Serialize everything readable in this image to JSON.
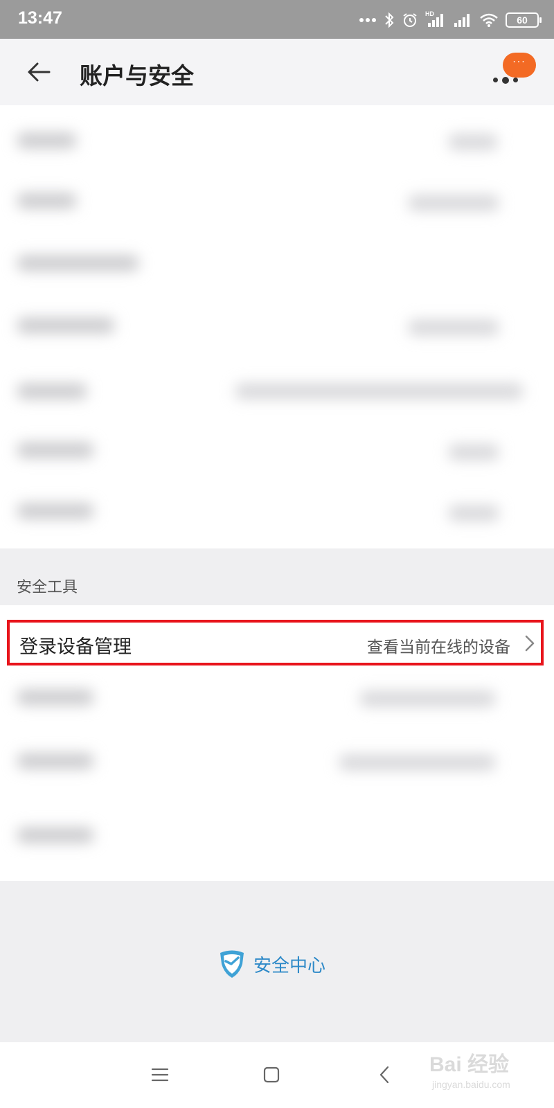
{
  "status_bar": {
    "time": "13:47",
    "network_label": "HD",
    "battery_level": "60",
    "icons": [
      "more-dots-icon",
      "bluetooth-icon",
      "alarm-icon",
      "signal-hd-icon",
      "signal-icon",
      "wifi-icon",
      "battery-icon"
    ]
  },
  "header": {
    "title": "账户与安全",
    "back_icon": "arrow-left-icon",
    "more_icon": "more-dots-icon",
    "notification_badge": "···"
  },
  "sections": {
    "tools_label": "安全工具"
  },
  "device_management": {
    "label": "登录设备管理",
    "value": "查看当前在线的设备",
    "chevron_icon": "chevron-right-icon"
  },
  "footer": {
    "security_center_label": "安全中心",
    "security_center_icon": "shield-icon"
  },
  "nav_bar": {
    "icons": [
      "menu-icon",
      "home-square-icon",
      "back-chevron-icon"
    ]
  },
  "watermark": {
    "main": "Bai 经验",
    "sub": "jingyan.baidu.com"
  },
  "colors": {
    "accent_orange": "#f36a24",
    "highlight_red": "#e8141b",
    "link_blue": "#2d89c8"
  }
}
